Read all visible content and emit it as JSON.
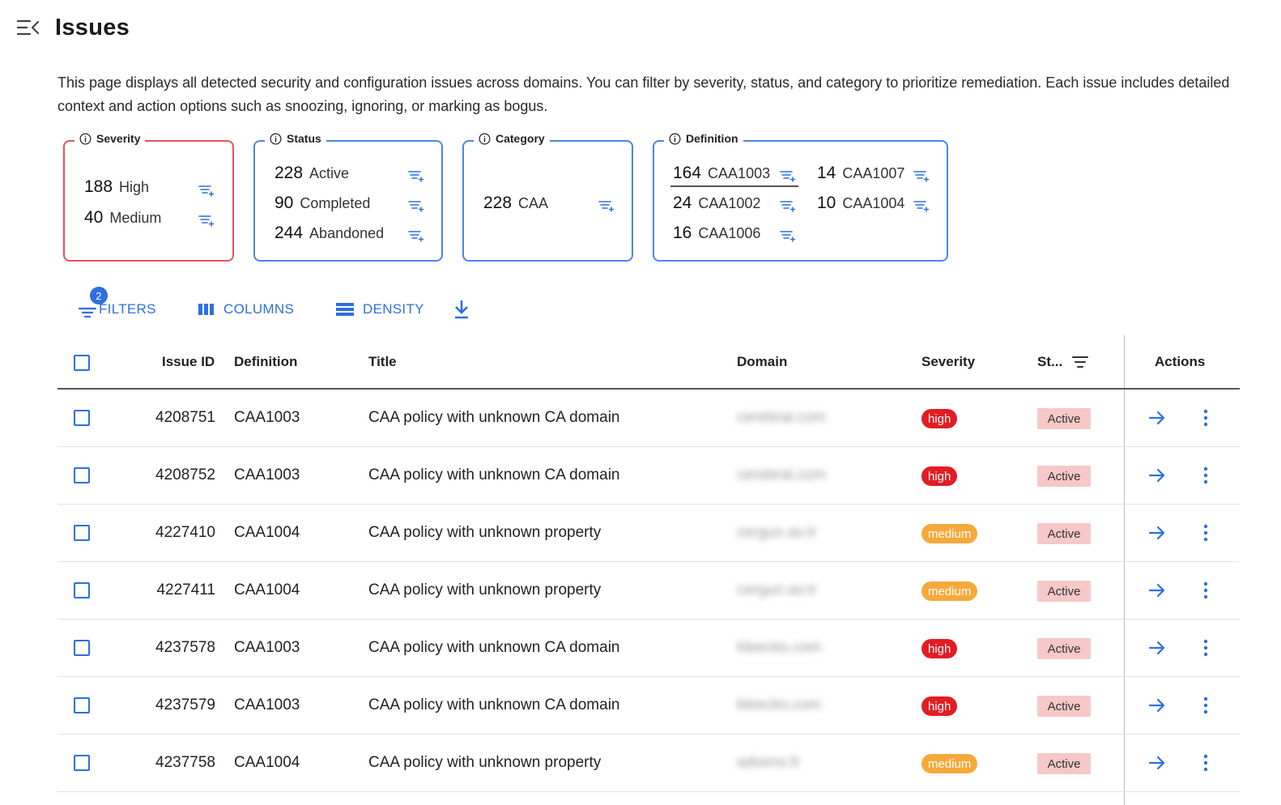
{
  "header": {
    "title": "Issues",
    "menu_icon": "menu-collapse-icon"
  },
  "description": "This page displays all detected security and configuration issues across domains. You can filter by severity, status, and category to prioritize remediation. Each issue includes detailed context and action options such as snoozing, ignoring, or marking as bogus.",
  "cards": {
    "severity": {
      "label": "Severity",
      "items": [
        {
          "count": "188",
          "label": "High"
        },
        {
          "count": "40",
          "label": "Medium"
        }
      ]
    },
    "status": {
      "label": "Status",
      "items": [
        {
          "count": "228",
          "label": "Active"
        },
        {
          "count": "90",
          "label": "Completed"
        },
        {
          "count": "244",
          "label": "Abandoned"
        }
      ]
    },
    "category": {
      "label": "Category",
      "items": [
        {
          "count": "228",
          "label": "CAA"
        }
      ]
    },
    "definition": {
      "label": "Definition",
      "items": [
        {
          "count": "164",
          "label": "CAA1003"
        },
        {
          "count": "24",
          "label": "CAA1002"
        },
        {
          "count": "16",
          "label": "CAA1006"
        },
        {
          "count": "14",
          "label": "CAA1007"
        },
        {
          "count": "10",
          "label": "CAA1004"
        }
      ]
    }
  },
  "toolbar": {
    "filters_label": "FILTERS",
    "filters_badge": "2",
    "columns_label": "COLUMNS",
    "density_label": "DENSITY"
  },
  "table": {
    "columns": {
      "issue_id": "Issue ID",
      "definition": "Definition",
      "title": "Title",
      "domain": "Domain",
      "severity": "Severity",
      "status": "St...",
      "actions": "Actions"
    },
    "rows": [
      {
        "id": "4208751",
        "definition": "CAA1003",
        "title": "CAA policy with unknown CA domain",
        "domain": "cerebral.com",
        "severity": "high",
        "status": "Active"
      },
      {
        "id": "4208752",
        "definition": "CAA1003",
        "title": "CAA policy with unknown CA domain",
        "domain": "cerebral.com",
        "severity": "high",
        "status": "Active"
      },
      {
        "id": "4227410",
        "definition": "CAA1004",
        "title": "CAA policy with unknown property",
        "domain": "cergun.av.tr",
        "severity": "medium",
        "status": "Active"
      },
      {
        "id": "4227411",
        "definition": "CAA1004",
        "title": "CAA policy with unknown property",
        "domain": "cergun.av.tr",
        "severity": "medium",
        "status": "Active"
      },
      {
        "id": "4237578",
        "definition": "CAA1003",
        "title": "CAA policy with unknown CA domain",
        "domain": "kleecks.com",
        "severity": "high",
        "status": "Active"
      },
      {
        "id": "4237579",
        "definition": "CAA1003",
        "title": "CAA policy with unknown CA domain",
        "domain": "kleecks.com",
        "severity": "high",
        "status": "Active"
      },
      {
        "id": "4237758",
        "definition": "CAA1004",
        "title": "CAA policy with unknown property",
        "domain": "advens.fr",
        "severity": "medium",
        "status": "Active"
      }
    ]
  },
  "colors": {
    "accent": "#2f6fe0",
    "severity_border": "#e05555",
    "high": "#e21d24",
    "medium": "#f6a93b",
    "status_active_bg": "#f6c8c8"
  }
}
